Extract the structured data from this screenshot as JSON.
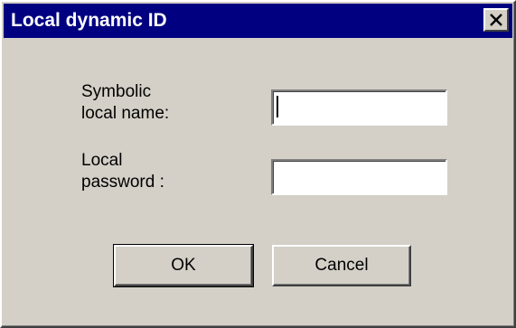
{
  "window": {
    "title": "Local dynamic ID",
    "close_icon": "close-x-icon"
  },
  "form": {
    "symbolic_name_label": "Symbolic\nlocal name:",
    "symbolic_name_value": "",
    "password_label": "Local\npassword :",
    "password_value": ""
  },
  "buttons": {
    "ok_label": "OK",
    "cancel_label": "Cancel"
  },
  "colors": {
    "titlebar": "#000080",
    "face": "#d4d0c8"
  }
}
